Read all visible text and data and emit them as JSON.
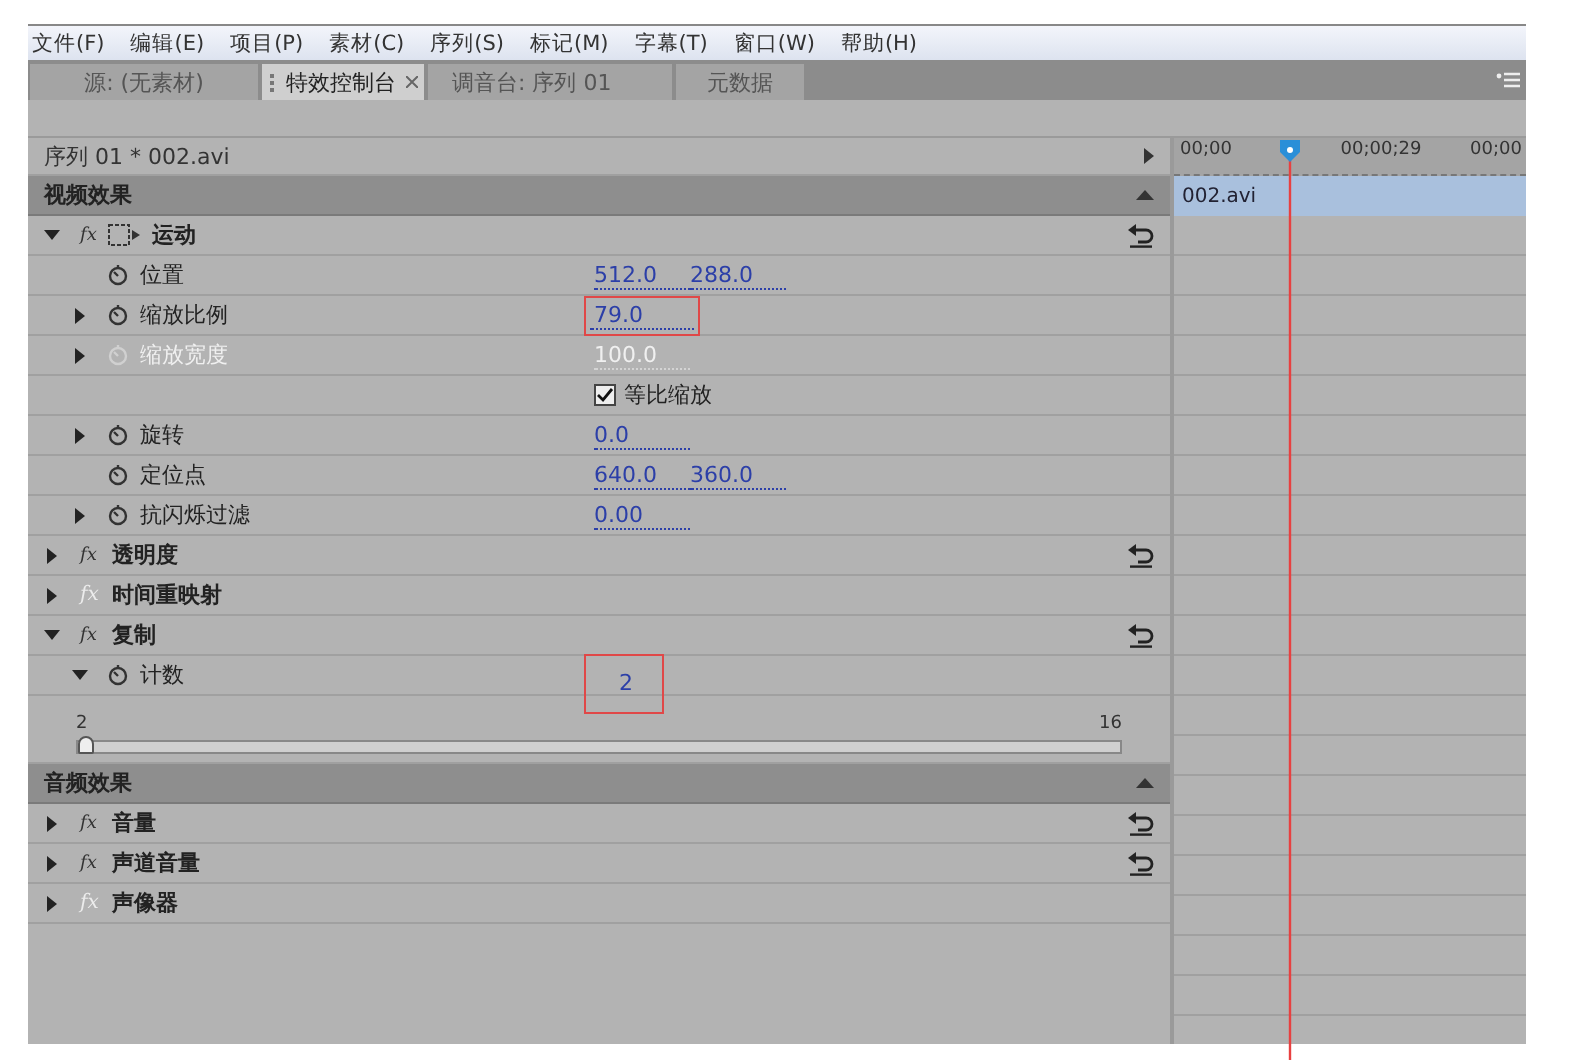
{
  "menu": [
    "文件(F)",
    "编辑(E)",
    "项目(P)",
    "素材(C)",
    "序列(S)",
    "标记(M)",
    "字幕(T)",
    "窗口(W)",
    "帮助(H)"
  ],
  "tabs": [
    {
      "label": "源: (无素材)",
      "selected": false
    },
    {
      "label": "特效控制台",
      "selected": true
    },
    {
      "label": "调音台: 序列 01",
      "selected": false
    },
    {
      "label": "元数据",
      "selected": false
    }
  ],
  "clip_header": "序列 01 * 002.avi",
  "sections": [
    {
      "title": "视频效果",
      "effects": [
        {
          "name": "运动",
          "badge": "fx",
          "enabled": true,
          "expanded": true,
          "has_transform_icon": true,
          "has_reset": true,
          "properties": [
            {
              "kind": "param",
              "name": "位置",
              "disabled": false,
              "values": [
                {
                  "text": "512.0",
                  "highlighted": false
                },
                {
                  "text": "288.0",
                  "highlighted": false
                }
              ]
            },
            {
              "kind": "param",
              "name": "缩放比例",
              "expanded": false,
              "disabled": false,
              "values": [
                {
                  "text": "79.0",
                  "highlighted": true
                }
              ]
            },
            {
              "kind": "param",
              "name": "缩放宽度",
              "expanded": false,
              "disabled": true,
              "values": [
                {
                  "text": "100.0",
                  "highlighted": false
                }
              ]
            },
            {
              "kind": "checkbox",
              "label": "等比缩放",
              "checked": true
            },
            {
              "kind": "param",
              "name": "旋转",
              "expanded": false,
              "disabled": false,
              "values": [
                {
                  "text": "0.0",
                  "highlighted": false
                }
              ]
            },
            {
              "kind": "param",
              "name": "定位点",
              "disabled": false,
              "values": [
                {
                  "text": "640.0",
                  "highlighted": false
                },
                {
                  "text": "360.0",
                  "highlighted": false
                }
              ]
            },
            {
              "kind": "param",
              "name": "抗闪烁过滤",
              "expanded": false,
              "disabled": false,
              "values": [
                {
                  "text": "0.00",
                  "highlighted": false
                }
              ]
            }
          ]
        },
        {
          "name": "透明度",
          "badge": "fx",
          "enabled": true,
          "expanded": false,
          "has_transform_icon": false,
          "has_reset": true
        },
        {
          "name": "时间重映射",
          "badge": "fx",
          "enabled": false,
          "expanded": false,
          "has_transform_icon": false,
          "has_reset": false
        },
        {
          "name": "复制",
          "badge": "fx",
          "enabled": true,
          "expanded": true,
          "has_transform_icon": false,
          "has_reset": true,
          "properties": [
            {
              "kind": "param",
              "name": "计数",
              "expanded": true,
              "disabled": false,
              "values": [
                {
                  "text": "2",
                  "highlighted": true
                }
              ],
              "slider": {
                "min": "2",
                "max": "16",
                "level": 0
              }
            }
          ]
        }
      ]
    },
    {
      "title": "音频效果",
      "effects": [
        {
          "name": "音量",
          "badge": "fx",
          "enabled": true,
          "expanded": false,
          "has_transform_icon": false,
          "has_reset": true
        },
        {
          "name": "声道音量",
          "badge": "fx",
          "enabled": true,
          "expanded": false,
          "has_transform_icon": false,
          "has_reset": true
        },
        {
          "name": "声像器",
          "badge": "fx",
          "enabled": false,
          "expanded": false,
          "has_transform_icon": false,
          "has_reset": false
        }
      ]
    }
  ],
  "timeline": {
    "ticks": [
      "00;00",
      "00;00;29",
      "00;00"
    ],
    "clip": "002.avi"
  }
}
